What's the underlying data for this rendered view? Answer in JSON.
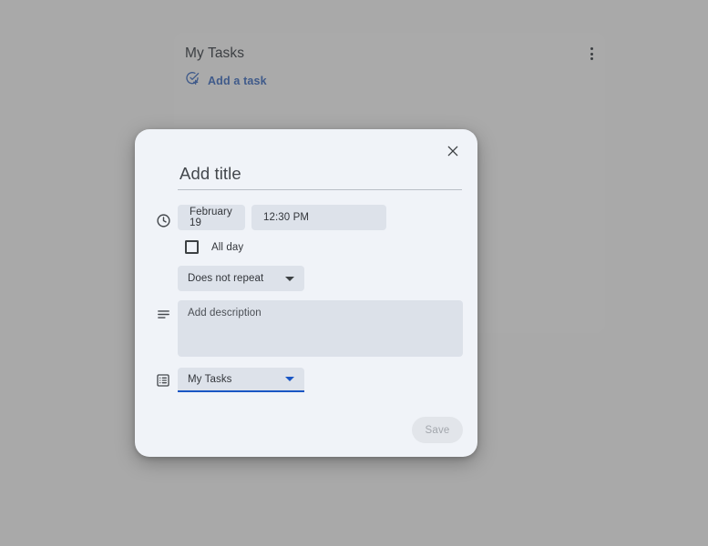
{
  "background_card": {
    "title": "My Tasks",
    "overflow_menu_icon": "more-vert-icon",
    "add_task": {
      "icon": "check-circle-plus-icon",
      "label": "Add a task"
    }
  },
  "dialog": {
    "close_icon": "close-icon",
    "title_field": {
      "value": "",
      "placeholder": "Add title"
    },
    "schedule_row": {
      "icon": "clock-icon",
      "date_chip": "February 19",
      "time_chip": "12:30 PM"
    },
    "all_day": {
      "label": "All day",
      "checked": false
    },
    "repeat": {
      "selected": "Does not repeat",
      "caret_icon": "chevron-down-icon"
    },
    "description": {
      "icon": "notes-icon",
      "value": "",
      "placeholder": "Add description"
    },
    "task_list": {
      "icon": "task-list-icon",
      "selected": "My Tasks",
      "caret_icon": "chevron-down-icon"
    },
    "save_button": {
      "label": "Save",
      "enabled": false
    }
  },
  "colors": {
    "scrim": "#a9a9a9",
    "dialog_bg": "#f0f3f8",
    "chip_bg": "#dde2ea",
    "desc_bg": "#dce1e9",
    "accent_blue": "#1a56c4",
    "link_blue": "#3f5a8a",
    "text_primary": "#32353a",
    "save_disabled_text": "#a3a7ad"
  }
}
